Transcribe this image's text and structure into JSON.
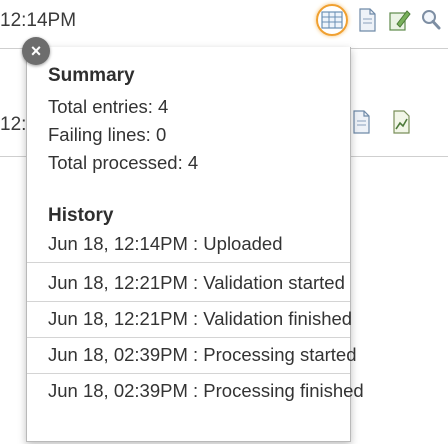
{
  "background": {
    "time_top": "12:14PM",
    "time_second_partial": "12:1"
  },
  "popup": {
    "close_label": "×",
    "summary": {
      "title": "Summary",
      "total_entries": "Total entries: 4",
      "failing_lines": "Failing lines: 0",
      "total_processed": "Total processed: 4"
    },
    "history": {
      "title": "History",
      "entries": [
        "Jun 18, 12:14PM : Uploaded",
        "Jun 18, 12:21PM : Validation started",
        "Jun 18, 12:21PM : Validation finished",
        "Jun 18, 02:39PM : Processing started",
        "Jun 18, 02:39PM : Processing finished"
      ]
    }
  },
  "icons": {
    "toolbar_top": [
      "table-icon",
      "document-icon",
      "edit-icon",
      "search-icon"
    ],
    "toolbar_second": [
      "document-icon",
      "chart-icon"
    ]
  },
  "colors": {
    "highlight_ring": "#f0a030",
    "close_button": "#6d6d6d",
    "divider": "#d4d4d4"
  }
}
